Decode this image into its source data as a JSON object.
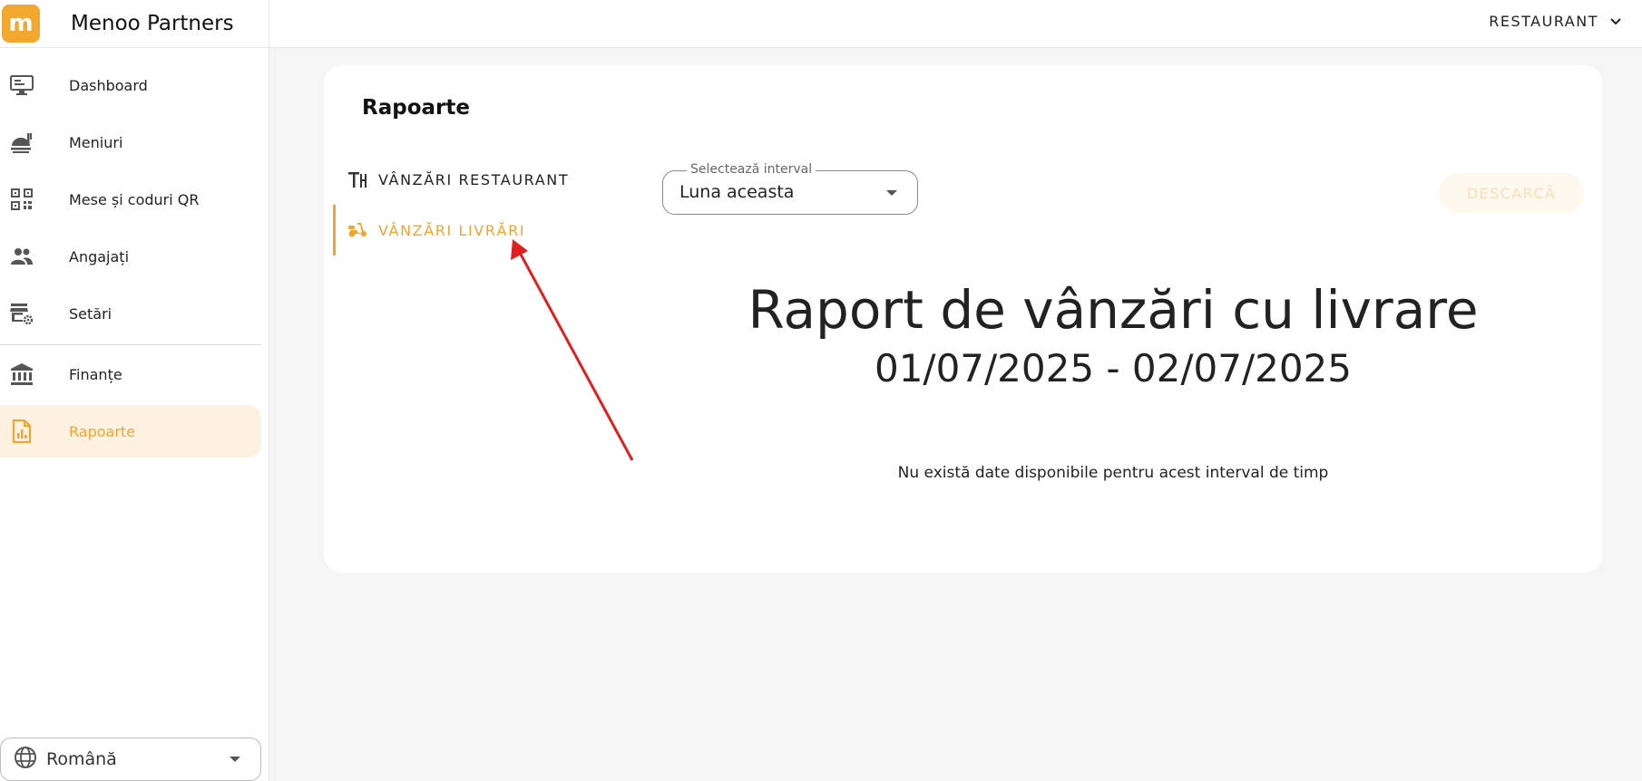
{
  "brand": {
    "name": "Menoo Partners",
    "logo_glyph": "m"
  },
  "topbar": {
    "restaurant_label": "RESTAURANT"
  },
  "sidebar": {
    "items": [
      {
        "label": "Dashboard",
        "icon": "monitor-icon"
      },
      {
        "label": "Meniuri",
        "icon": "food-tray-icon"
      },
      {
        "label": "Mese și coduri QR",
        "icon": "qr-code-icon"
      },
      {
        "label": "Angajați",
        "icon": "people-icon"
      },
      {
        "label": "Setări",
        "icon": "store-settings-icon"
      },
      {
        "label": "Finanțe",
        "icon": "bank-icon"
      },
      {
        "label": "Rapoarte",
        "icon": "report-icon",
        "active": true
      }
    ],
    "language": {
      "label": "Română",
      "icon": "globe-icon"
    }
  },
  "main": {
    "title": "Rapoarte",
    "tabs": [
      {
        "label": "VÂNZĂRI RESTAURANT",
        "icon": "table-dining-icon",
        "active": false
      },
      {
        "label": "VÂNZĂRI LIVRĂRI",
        "icon": "scooter-icon",
        "active": true
      }
    ],
    "interval": {
      "legend": "Selectează interval",
      "value": "Luna aceasta"
    },
    "download_label": "DESCARCĂ",
    "report": {
      "heading": "Raport de vânzări cu livrare",
      "date_range": "01/07/2025 - 02/07/2025",
      "empty_message": "Nu există date disponibile pentru acest interval de timp"
    }
  },
  "colors": {
    "accent": "#f0a531",
    "active_bg": "#fdf2e2",
    "background": "#f5f5f5",
    "annotation_arrow": "#e02020"
  }
}
